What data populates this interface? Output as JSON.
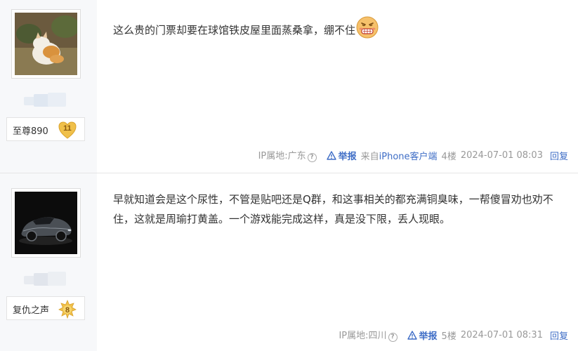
{
  "posts": [
    {
      "username": "至尊890",
      "level": "11",
      "content": "这么贵的门票却要在球馆铁皮屋里面蒸桑拿，绷不住",
      "emoji_icon": "grimace-emoji-icon",
      "ip_location": "IP属地:广东",
      "report_label": "举报",
      "client_prefix": "来自",
      "client_name": "iPhone客户端",
      "floor": "4楼",
      "timestamp": "2024-07-01 08:03",
      "reply_label": "回复"
    },
    {
      "username": "复仇之声",
      "level": "8",
      "content": "早就知道会是这个尿性，不管是贴吧还是Q群，和这事相关的都充满铜臭味，一帮傻冒劝也劝不住，这就是周瑜打黄盖。一个游戏能完成这样，真是没下限，丢人现眼。",
      "ip_location": "IP属地:四川",
      "report_label": "举报",
      "floor": "5楼",
      "timestamp": "2024-07-01 08:31",
      "reply_label": "回复"
    }
  ],
  "colors": {
    "link": "#3e6dc6",
    "meta": "#999999",
    "sidebar": "#f7f8fa",
    "badge_gold": "#f0c04a"
  }
}
